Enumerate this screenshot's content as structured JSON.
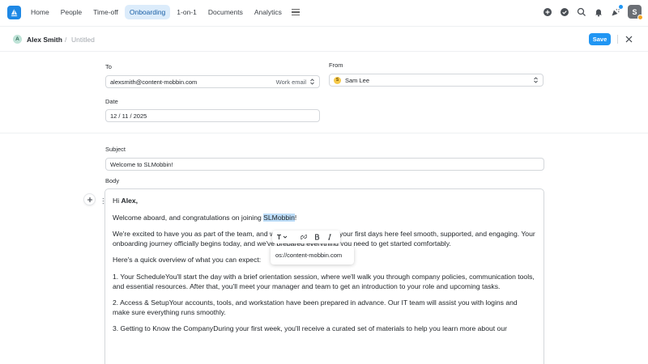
{
  "nav": {
    "items": [
      {
        "label": "Home",
        "active": false
      },
      {
        "label": "People",
        "active": false
      },
      {
        "label": "Time-off",
        "active": false
      },
      {
        "label": "Onboarding",
        "active": true
      },
      {
        "label": "1-on-1",
        "active": false
      },
      {
        "label": "Documents",
        "active": false
      },
      {
        "label": "Analytics",
        "active": false
      }
    ],
    "icons": [
      "plus-circle-icon",
      "check-circle-icon",
      "search-icon",
      "bell-icon",
      "party-popper-icon"
    ],
    "user_initial": "S"
  },
  "header": {
    "avatar_initial": "A",
    "name": "Alex Smith",
    "separator": "/",
    "title": "Untitled",
    "save_label": "Save"
  },
  "form": {
    "to_label": "To",
    "to_value": "alexsmith@content-mobbin.com",
    "to_type": "Work email",
    "from_label": "From",
    "from_avatar": "S",
    "from_value": "Sam Lee",
    "date_label": "Date",
    "date_value": "12 / 11 / 2025",
    "subject_label": "Subject",
    "subject_value": "Welcome to SLMobbin!",
    "body_label": "Body"
  },
  "body": {
    "greeting_pre": "Hi ",
    "greeting_name": "Alex,",
    "welcome_pre": "Welcome aboard, and congratulations on joining ",
    "welcome_company": "SLMobbin",
    "welcome_post": "!",
    "p1": "We're excited to have you as part of the team, and we want to make sure your first days here feel smooth, supported, and engaging. Your onboarding journey officially begins today, and we've prepared everything you need to get started comfortably.",
    "p2": "Here's a quick overview of what you can expect:",
    "p3": "1. Your ScheduleYou'll start the day with a brief orientation session, where we'll walk you through company policies, communication tools, and essential resources. After that, you'll meet your manager and team to get an introduction to your role and upcoming tasks.",
    "p4": "2. Access & SetupYour accounts, tools, and workstation have been prepared in advance. Our IT team will assist you with logins and make sure everything runs smoothly.",
    "p5": "3. Getting to Know the CompanyDuring your first week, you'll receive a curated set of materials to help you learn more about our"
  },
  "link_popover": {
    "url": "os://content-mobbin.com"
  },
  "colors": {
    "accent": "#2196f3",
    "nav_active_bg": "#dcecfb",
    "highlight": "#bcdcf7"
  }
}
